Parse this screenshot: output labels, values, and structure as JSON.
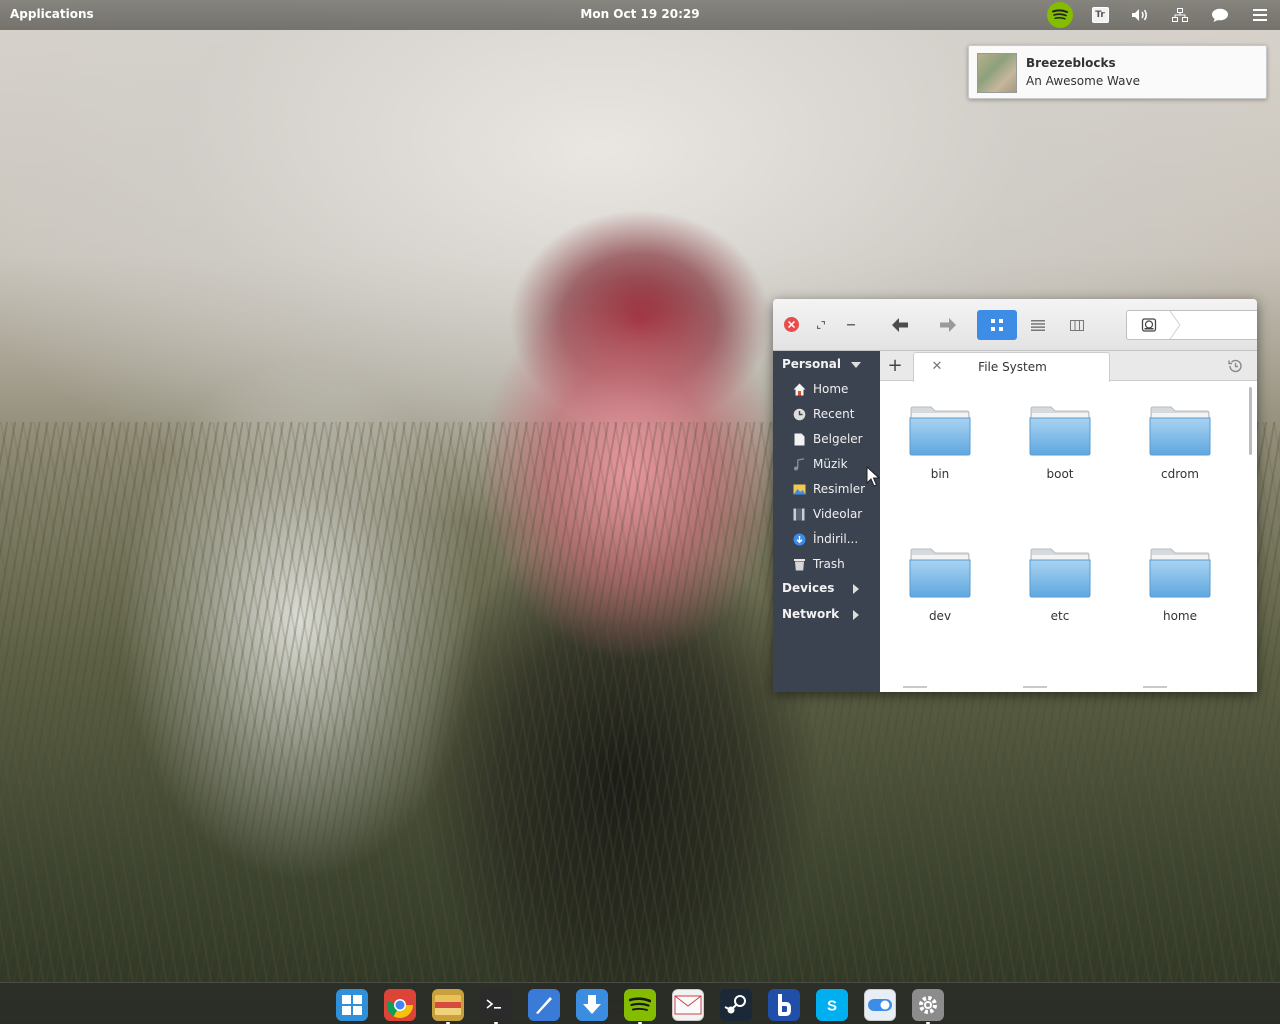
{
  "panel": {
    "applications_label": "Applications",
    "clock": "Mon Oct 19 20:29",
    "keyboard_layout": "Tr"
  },
  "notification": {
    "title": "Breezeblocks",
    "body": "An Awesome Wave"
  },
  "file_manager": {
    "sidebar": {
      "personal_label": "Personal",
      "items": [
        {
          "label": "Home",
          "icon": "home-icon"
        },
        {
          "label": "Recent",
          "icon": "recent-icon"
        },
        {
          "label": "Belgeler",
          "icon": "documents-icon"
        },
        {
          "label": "Müzik",
          "icon": "music-icon"
        },
        {
          "label": "Resimler",
          "icon": "pictures-icon"
        },
        {
          "label": "Videolar",
          "icon": "videos-icon"
        },
        {
          "label": "İndiril...",
          "icon": "downloads-icon"
        },
        {
          "label": "Trash",
          "icon": "trash-icon"
        }
      ],
      "devices_label": "Devices",
      "network_label": "Network"
    },
    "tab": {
      "label": "File System"
    },
    "folders": [
      {
        "name": "bin"
      },
      {
        "name": "boot"
      },
      {
        "name": "cdrom"
      },
      {
        "name": "dev"
      },
      {
        "name": "etc"
      },
      {
        "name": "home"
      }
    ]
  },
  "dock": {
    "items": [
      {
        "name": "multitasking-view",
        "icon": "multitasking-icon",
        "color": "#2f8fd8"
      },
      {
        "name": "chrome",
        "icon": "chrome-icon",
        "color": "#db4437"
      },
      {
        "name": "files",
        "icon": "files-icon",
        "color": "#c9a13c"
      },
      {
        "name": "terminal",
        "icon": "terminal-icon",
        "color": "#2b2b2b"
      },
      {
        "name": "scratch",
        "icon": "scratch-editor-icon",
        "color": "#3b7bd8"
      },
      {
        "name": "downloader",
        "icon": "download-icon",
        "color": "#3a8de0"
      },
      {
        "name": "spotify",
        "icon": "spotify-icon",
        "color": "#84bd00"
      },
      {
        "name": "mail",
        "icon": "mail-icon",
        "color": "#f2f2f2"
      },
      {
        "name": "steam",
        "icon": "steam-icon",
        "color": "#1b2838"
      },
      {
        "name": "bitlbee",
        "icon": "b-letter-icon",
        "color": "#1f4fa8"
      },
      {
        "name": "skype",
        "icon": "skype-icon",
        "color": "#00aff0"
      },
      {
        "name": "switchboard-toggle",
        "icon": "toggle-icon",
        "color": "#e8eef5"
      },
      {
        "name": "system-settings",
        "icon": "settings-icon",
        "color": "#8c8c8c"
      }
    ]
  }
}
